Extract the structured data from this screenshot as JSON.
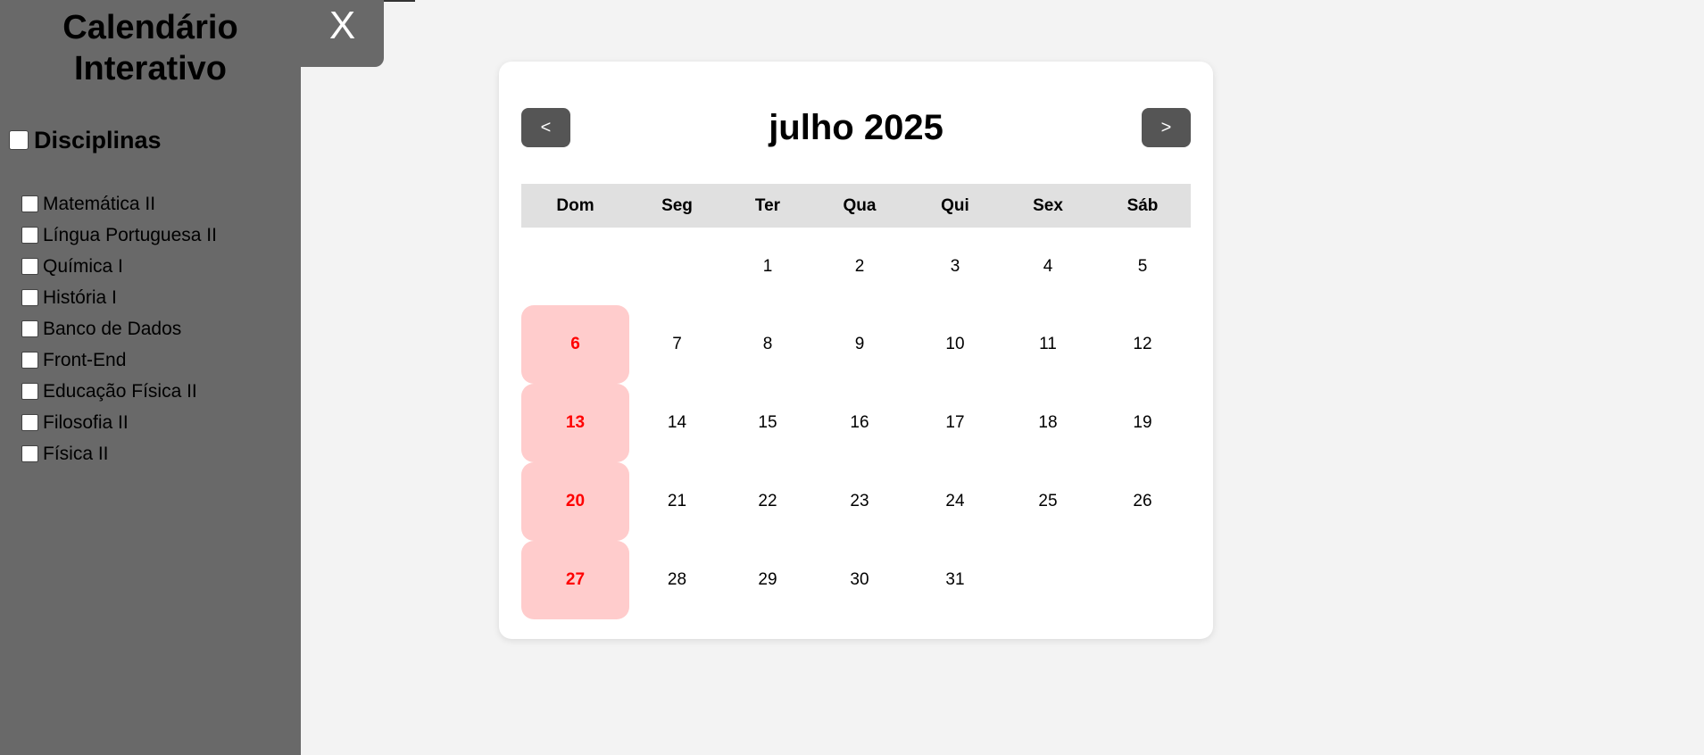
{
  "sidebar": {
    "title_line1": "Calendário",
    "title_line2": "Interativo",
    "close_label": "X",
    "group_label": "Disciplinas",
    "subjects": [
      "Matemática II",
      "Língua Portuguesa II",
      "Química I",
      "História I",
      "Banco de Dados",
      "Front-End",
      "Educação Física II",
      "Filosofia II",
      "Física II"
    ]
  },
  "calendar": {
    "month_label": "julho 2025",
    "prev_label": "<",
    "next_label": ">",
    "weekdays": [
      "Dom",
      "Seg",
      "Ter",
      "Qua",
      "Qui",
      "Sex",
      "Sáb"
    ],
    "weeks": [
      [
        "",
        "",
        "1",
        "2",
        "3",
        "4",
        "5"
      ],
      [
        "6",
        "7",
        "8",
        "9",
        "10",
        "11",
        "12"
      ],
      [
        "13",
        "14",
        "15",
        "16",
        "17",
        "18",
        "19"
      ],
      [
        "20",
        "21",
        "22",
        "23",
        "24",
        "25",
        "26"
      ],
      [
        "27",
        "28",
        "29",
        "30",
        "31",
        "",
        ""
      ]
    ]
  },
  "colors": {
    "sidebar_bg": "#696969",
    "page_bg": "#f3f3f3",
    "sunday_text": "#ff0000",
    "sunday_bg": "#ffcccc",
    "nav_button_bg": "#555555",
    "weekday_header_bg": "#e0e0e0"
  }
}
